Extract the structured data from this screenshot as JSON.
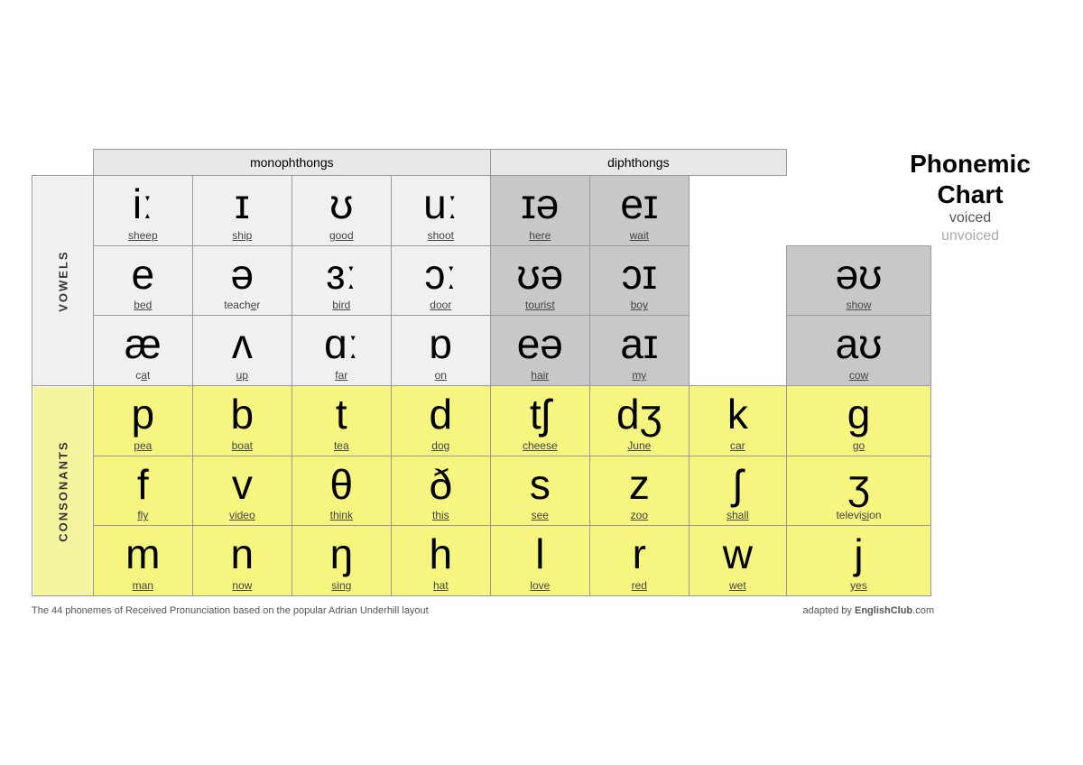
{
  "title": {
    "line1": "Phonemic",
    "line2": "Chart",
    "voiced": "voiced",
    "unvoiced": "unvoiced"
  },
  "headers": {
    "monophthongs": "monophthongs",
    "diphthongs": "diphthongs"
  },
  "vowels_label": "VOWELS",
  "consonants_label": "CONSONANTS",
  "vowel_rows": [
    {
      "cells": [
        {
          "symbol": "iː",
          "word": "sheep",
          "underline": "sheep",
          "bg": "mono"
        },
        {
          "symbol": "ɪ",
          "word": "ship",
          "underline": "ship",
          "bg": "mono"
        },
        {
          "symbol": "ʊ",
          "word": "good",
          "underline": "good",
          "bg": "mono"
        },
        {
          "symbol": "uː",
          "word": "shoot",
          "underline": "shoot",
          "bg": "mono"
        },
        {
          "symbol": "ɪə",
          "word": "here",
          "underline": "here",
          "bg": "diph"
        },
        {
          "symbol": "eɪ",
          "word": "wait",
          "underline": "wait",
          "bg": "diph"
        }
      ]
    },
    {
      "cells": [
        {
          "symbol": "e",
          "word": "bed",
          "underline": "bed",
          "bg": "mono"
        },
        {
          "symbol": "ə",
          "word": "teacher",
          "underline": "teacher",
          "bg": "mono"
        },
        {
          "symbol": "ɜː",
          "word": "bird",
          "underline": "bird",
          "bg": "mono"
        },
        {
          "symbol": "ɔː",
          "word": "door",
          "underline": "door",
          "bg": "mono"
        },
        {
          "symbol": "ʊə",
          "word": "tourist",
          "underline": "tourist",
          "bg": "diph"
        },
        {
          "symbol": "ɔɪ",
          "word": "boy",
          "underline": "boy",
          "bg": "diph"
        },
        {
          "symbol": "əʊ",
          "word": "show",
          "underline": "show",
          "bg": "diph"
        }
      ]
    },
    {
      "cells": [
        {
          "symbol": "æ",
          "word": "cat",
          "underline": "cat",
          "bg": "mono"
        },
        {
          "symbol": "ʌ",
          "word": "up",
          "underline": "up",
          "bg": "mono"
        },
        {
          "symbol": "ɑː",
          "word": "far",
          "underline": "far",
          "bg": "mono"
        },
        {
          "symbol": "ɒ",
          "word": "on",
          "underline": "on",
          "bg": "mono"
        },
        {
          "symbol": "eə",
          "word": "hair",
          "underline": "hair",
          "bg": "diph"
        },
        {
          "symbol": "aɪ",
          "word": "my",
          "underline": "my",
          "bg": "diph"
        },
        {
          "symbol": "aʊ",
          "word": "cow",
          "underline": "cow",
          "bg": "diph"
        }
      ]
    }
  ],
  "consonant_rows": [
    {
      "cells": [
        {
          "symbol": "p",
          "word": "pea",
          "underline": "pea"
        },
        {
          "symbol": "b",
          "word": "boat",
          "underline": "boat"
        },
        {
          "symbol": "t",
          "word": "tea",
          "underline": "tea"
        },
        {
          "symbol": "d",
          "word": "dog",
          "underline": "dog"
        },
        {
          "symbol": "tʃ",
          "word": "cheese",
          "underline": "cheese"
        },
        {
          "symbol": "dʒ",
          "word": "June",
          "underline": "June"
        },
        {
          "symbol": "k",
          "word": "car",
          "underline": "car"
        },
        {
          "symbol": "g",
          "word": "go",
          "underline": "go"
        }
      ]
    },
    {
      "cells": [
        {
          "symbol": "f",
          "word": "fly",
          "underline": "fly"
        },
        {
          "symbol": "v",
          "word": "video",
          "underline": "video"
        },
        {
          "symbol": "θ",
          "word": "think",
          "underline": "think"
        },
        {
          "symbol": "ð",
          "word": "this",
          "underline": "this"
        },
        {
          "symbol": "s",
          "word": "see",
          "underline": "see"
        },
        {
          "symbol": "z",
          "word": "zoo",
          "underline": "zoo"
        },
        {
          "symbol": "ʃ",
          "word": "shall",
          "underline": "shall"
        },
        {
          "symbol": "ʒ",
          "word": "television",
          "underline": "television"
        }
      ]
    },
    {
      "cells": [
        {
          "symbol": "m",
          "word": "man",
          "underline": "man"
        },
        {
          "symbol": "n",
          "word": "now",
          "underline": "now"
        },
        {
          "symbol": "ŋ",
          "word": "sing",
          "underline": "sing"
        },
        {
          "symbol": "h",
          "word": "hat",
          "underline": "hat"
        },
        {
          "symbol": "l",
          "word": "love",
          "underline": "love"
        },
        {
          "symbol": "r",
          "word": "red",
          "underline": "red"
        },
        {
          "symbol": "w",
          "word": "wet",
          "underline": "wet"
        },
        {
          "symbol": "j",
          "word": "yes",
          "underline": "yes"
        }
      ]
    }
  ],
  "footer": {
    "note": "The 44 phonemes of Received Pronunciation based on the popular Adrian Underhill layout",
    "adapted": "adapted by",
    "brand": "EnglishClub",
    "dot_com": ".com"
  }
}
